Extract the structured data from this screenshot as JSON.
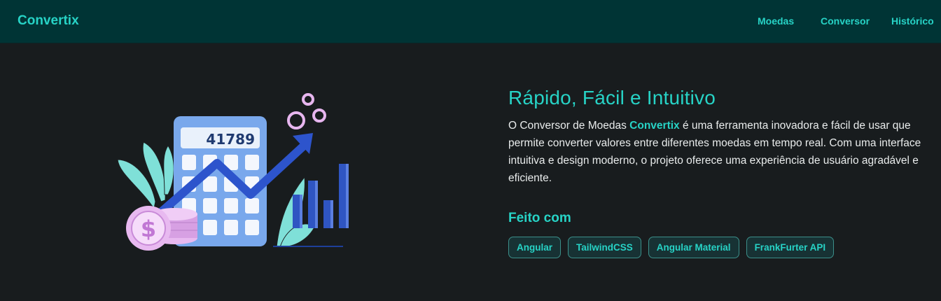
{
  "navbar": {
    "brand": "Convertix",
    "links": [
      "Moedas",
      "Conversor",
      "Histórico"
    ]
  },
  "illustration": {
    "calculator_display": "41789",
    "coin_symbol": "$"
  },
  "hero": {
    "title": "Rápido, Fácil e Intuitivo",
    "desc_before": "O Conversor de Moedas ",
    "desc_brand": "Convertix",
    "desc_after": " é uma ferramenta inovadora e fácil de usar que permite converter valores entre diferentes moedas em tempo real. Com uma interface intuitiva e design moderno, o projeto oferece uma experiência de usuário agradável e eficiente."
  },
  "built_with": {
    "title": "Feito com",
    "chips": [
      "Angular",
      "TailwindCSS",
      "Angular Material",
      "FrankFurter API"
    ]
  },
  "colors": {
    "accent": "#27d3c6",
    "navbar_bg": "#003435",
    "page_bg": "#181c1e"
  }
}
